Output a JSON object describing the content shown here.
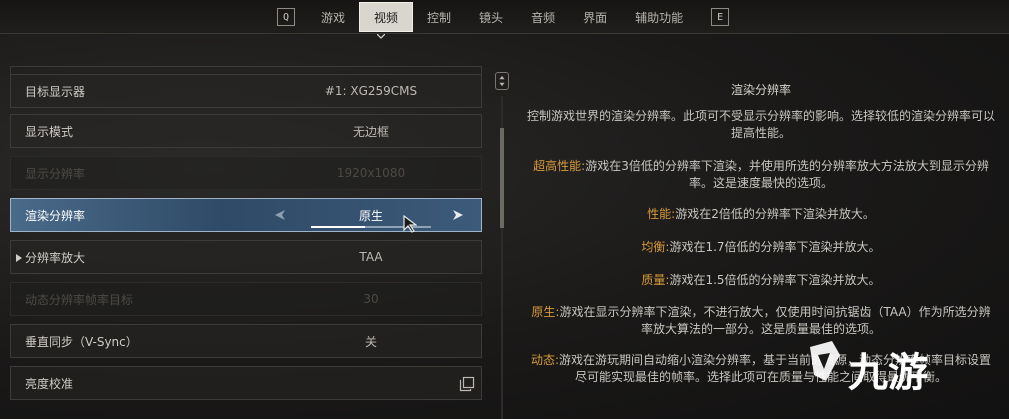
{
  "nav": {
    "left_key": "Q",
    "right_key": "E",
    "tabs": [
      {
        "label": "游戏"
      },
      {
        "label": "视频",
        "active": true
      },
      {
        "label": "控制"
      },
      {
        "label": "镜头"
      },
      {
        "label": "音频"
      },
      {
        "label": "界面"
      },
      {
        "label": "辅助功能"
      }
    ]
  },
  "settings": {
    "rows": [
      {
        "label": "目标显示器",
        "value": "#1: XG259CMS",
        "state": "normal"
      },
      {
        "label": "显示模式",
        "value": "无边框",
        "state": "normal"
      },
      {
        "label": "显示分辨率",
        "value": "1920x1080",
        "state": "disabled"
      },
      {
        "label": "渲染分辨率",
        "value": "原生",
        "state": "selected"
      },
      {
        "label": "分辨率放大",
        "value": "TAA",
        "state": "normal"
      },
      {
        "label": "动态分辨率帧率目标",
        "value": "30",
        "state": "disabled"
      },
      {
        "label": "垂直同步（V-Sync）",
        "value": "关",
        "state": "normal"
      },
      {
        "label": "亮度校准",
        "value": "",
        "state": "normal"
      }
    ]
  },
  "description": {
    "title": "渲染分辨率",
    "intro": "控制游戏世界的渲染分辨率。此项可不受显示分辨率的影响。选择较低的渲染分辨率可以提高性能。",
    "items": [
      {
        "keyword": "超高性能:",
        "text": "游戏在3倍低的分辨率下渲染，并使用所选的分辨率放大方法放大到显示分辨率。这是速度最快的选项。"
      },
      {
        "keyword": "性能:",
        "text": "游戏在2倍低的分辨率下渲染并放大。"
      },
      {
        "keyword": "均衡:",
        "text": "游戏在1.7倍低的分辨率下渲染并放大。"
      },
      {
        "keyword": "质量:",
        "text": "游戏在1.5倍低的分辨率下渲染并放大。"
      },
      {
        "keyword": "原生:",
        "text": "游戏在显示分辨率下渲染，不进行放大，仅使用时间抗锯齿（TAA）作为所选分辨率放大算法的一部分。这是质量最佳的选项。"
      },
      {
        "keyword": "动态:",
        "text": "游戏在游玩期间自动缩小渲染分辨率，基于当前的资源，动态分辨率帧率目标设置尽可能实现最佳的帧率。选择此项可在质量与性能之间取得最优平衡。"
      }
    ]
  },
  "colors": {
    "accent_keyword": "#d79a3a",
    "selected_row": "#4a6a8a"
  },
  "watermark": {
    "text": "九游"
  }
}
